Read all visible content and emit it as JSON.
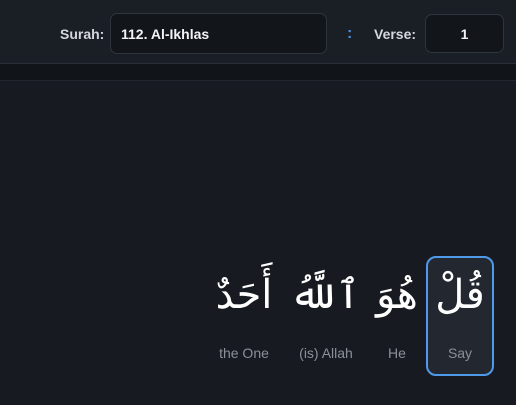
{
  "toolbar": {
    "surah_label": "Surah:",
    "surah_value": "112. Al-Ikhlas",
    "separator": ":",
    "verse_label": "Verse:",
    "verse_value": "1"
  },
  "verse": {
    "words": [
      {
        "arabic": "قُلْ",
        "translation": "Say",
        "selected": true
      },
      {
        "arabic": "هُوَ",
        "translation": "He",
        "selected": false
      },
      {
        "arabic": "ٱللَّهُ",
        "translation": "(is) Allah",
        "selected": false
      },
      {
        "arabic": "أَحَدٌ",
        "translation": "the One",
        "selected": false
      }
    ]
  },
  "colors": {
    "background": "#111418",
    "panel": "#171b21",
    "accent": "#4f9ae8",
    "translation_text": "#8a9099"
  }
}
